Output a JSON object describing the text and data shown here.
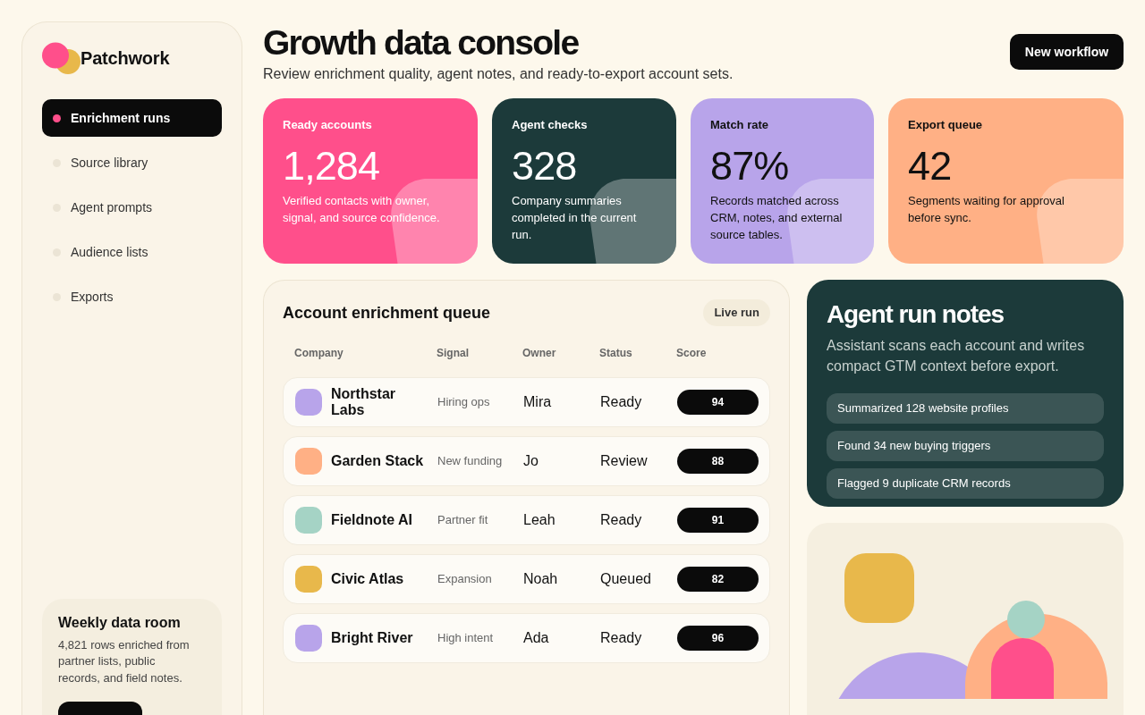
{
  "sidebar": {
    "brand": "Patchwork",
    "nav_items": [
      {
        "label": "Enrichment runs",
        "selected": true
      },
      {
        "label": "Source library",
        "selected": false
      },
      {
        "label": "Agent prompts",
        "selected": false
      },
      {
        "label": "Audience lists",
        "selected": false
      },
      {
        "label": "Exports",
        "selected": false
      }
    ],
    "promo_card": {
      "title": "Weekly data room",
      "text": "4,821 rows enriched from partner lists, public records, and field notes."
    }
  },
  "header": {
    "title": "Growth data console",
    "subtitle": "Review enrichment quality, agent notes, and ready-to-export account sets.",
    "button": "New workflow"
  },
  "stats": [
    {
      "label": "Ready accounts",
      "value": "1,284",
      "description": "Verified contacts with owner, signal, and source confidence.",
      "color": "#ff4f8b"
    },
    {
      "label": "Agent checks",
      "value": "328",
      "description": "Company summaries completed in the current run.",
      "color": "#1c3a3a"
    },
    {
      "label": "Match rate",
      "value": "87%",
      "description": "Records matched across CRM, notes, and external source tables.",
      "color": "#b8a4ea"
    },
    {
      "label": "Export queue",
      "value": "42",
      "description": "Segments waiting for approval before sync.",
      "color": "#ffb085"
    }
  ],
  "queue": {
    "title": "Account enrichment queue",
    "badge": "Live run",
    "columns": [
      "Company",
      "Signal",
      "Owner",
      "Status",
      "Score"
    ],
    "rows": [
      {
        "company": "Northstar Labs",
        "color": "#b8a4ea",
        "signal": "Hiring ops",
        "owner": "Mira",
        "status": "Ready",
        "score": "94"
      },
      {
        "company": "Garden Stack",
        "color": "#ffb085",
        "signal": "New funding",
        "owner": "Jo",
        "status": "Review",
        "score": "88"
      },
      {
        "company": "Fieldnote AI",
        "color": "#a5d3c5",
        "signal": "Partner fit",
        "owner": "Leah",
        "status": "Ready",
        "score": "91"
      },
      {
        "company": "Civic Atlas",
        "color": "#e8b84b",
        "signal": "Expansion",
        "owner": "Noah",
        "status": "Queued",
        "score": "82"
      },
      {
        "company": "Bright River",
        "color": "#b8a4ea",
        "signal": "High intent",
        "owner": "Ada",
        "status": "Ready",
        "score": "96"
      }
    ]
  },
  "run_notes": {
    "title": "Agent run notes",
    "description": "Assistant scans each account and writes compact GTM context before export.",
    "items": [
      "Summarized 128 website profiles",
      "Found 34 new buying triggers",
      "Flagged 9 duplicate CRM records"
    ]
  }
}
